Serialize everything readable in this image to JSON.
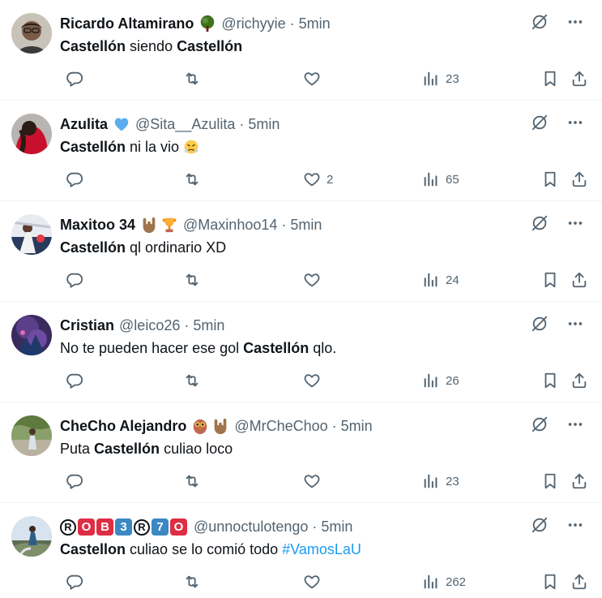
{
  "tweets": [
    {
      "name": "Ricardo Altamirano",
      "emojis": [
        "tree-emoji"
      ],
      "handle": "@richyyie",
      "dot": "·",
      "time": "5min",
      "text": [
        {
          "t": "Castellón",
          "b": true
        },
        {
          "t": " siendo "
        },
        {
          "t": "Castellón",
          "b": true
        }
      ],
      "likes": "",
      "views": "23"
    },
    {
      "name": "Azulita",
      "emojis": [
        "blue-heart-emoji"
      ],
      "handle": "@Sita__Azulita",
      "dot": "·",
      "time": "5min",
      "text": [
        {
          "t": "Castellón",
          "b": true
        },
        {
          "t": " ni la vio "
        }
      ],
      "text_emoji": "steam-nose-emoji",
      "likes": "2",
      "views": "65"
    },
    {
      "name": "Maxitoo 34",
      "emojis": [
        "horns-hand-emoji",
        "trophy-emoji"
      ],
      "handle": "@Maxinhoo14",
      "dot": "·",
      "time": "5min",
      "text": [
        {
          "t": "Castellón",
          "b": true
        },
        {
          "t": " ql ordinario XD"
        }
      ],
      "likes": "",
      "views": "24"
    },
    {
      "name": "Cristian",
      "emojis": [],
      "handle": "@leico26",
      "dot": "·",
      "time": "5min",
      "text": [
        {
          "t": "No te pueden hacer ese gol "
        },
        {
          "t": "Castellón",
          "b": true
        },
        {
          "t": " qlo."
        }
      ],
      "likes": "",
      "views": "26"
    },
    {
      "name": "CheCho Alejandro",
      "emojis": [
        "owl-emoji",
        "horns-hand-emoji"
      ],
      "handle": "@MrCheChoo",
      "dot": "·",
      "time": "5min",
      "text": [
        {
          "t": "Puta "
        },
        {
          "t": "Castellón",
          "b": true
        },
        {
          "t": " culiao loco"
        }
      ],
      "likes": "",
      "views": "23"
    },
    {
      "name": "ⓇOB3Ⓡ70",
      "name_badges": [
        {
          "c": "R",
          "style": "circ"
        },
        {
          "c": "O",
          "style": "red"
        },
        {
          "c": "B",
          "style": "red"
        },
        {
          "c": "3",
          "style": "blue"
        },
        {
          "c": "R",
          "style": "circ"
        },
        {
          "c": "7",
          "style": "blue"
        },
        {
          "c": "O",
          "style": "red"
        }
      ],
      "emojis": [],
      "handle": "@unnoctulotengo",
      "dot": "·",
      "time": "5min",
      "text": [
        {
          "t": "Castellon",
          "b": true
        },
        {
          "t": " culiao se lo comió todo "
        },
        {
          "t": "#VamosLaU",
          "h": true
        }
      ],
      "likes": "",
      "views": "262"
    }
  ],
  "colors": {
    "text": "#0f1419",
    "muted": "#536471",
    "link": "#1d9bf0",
    "divider": "#eff3f4"
  }
}
